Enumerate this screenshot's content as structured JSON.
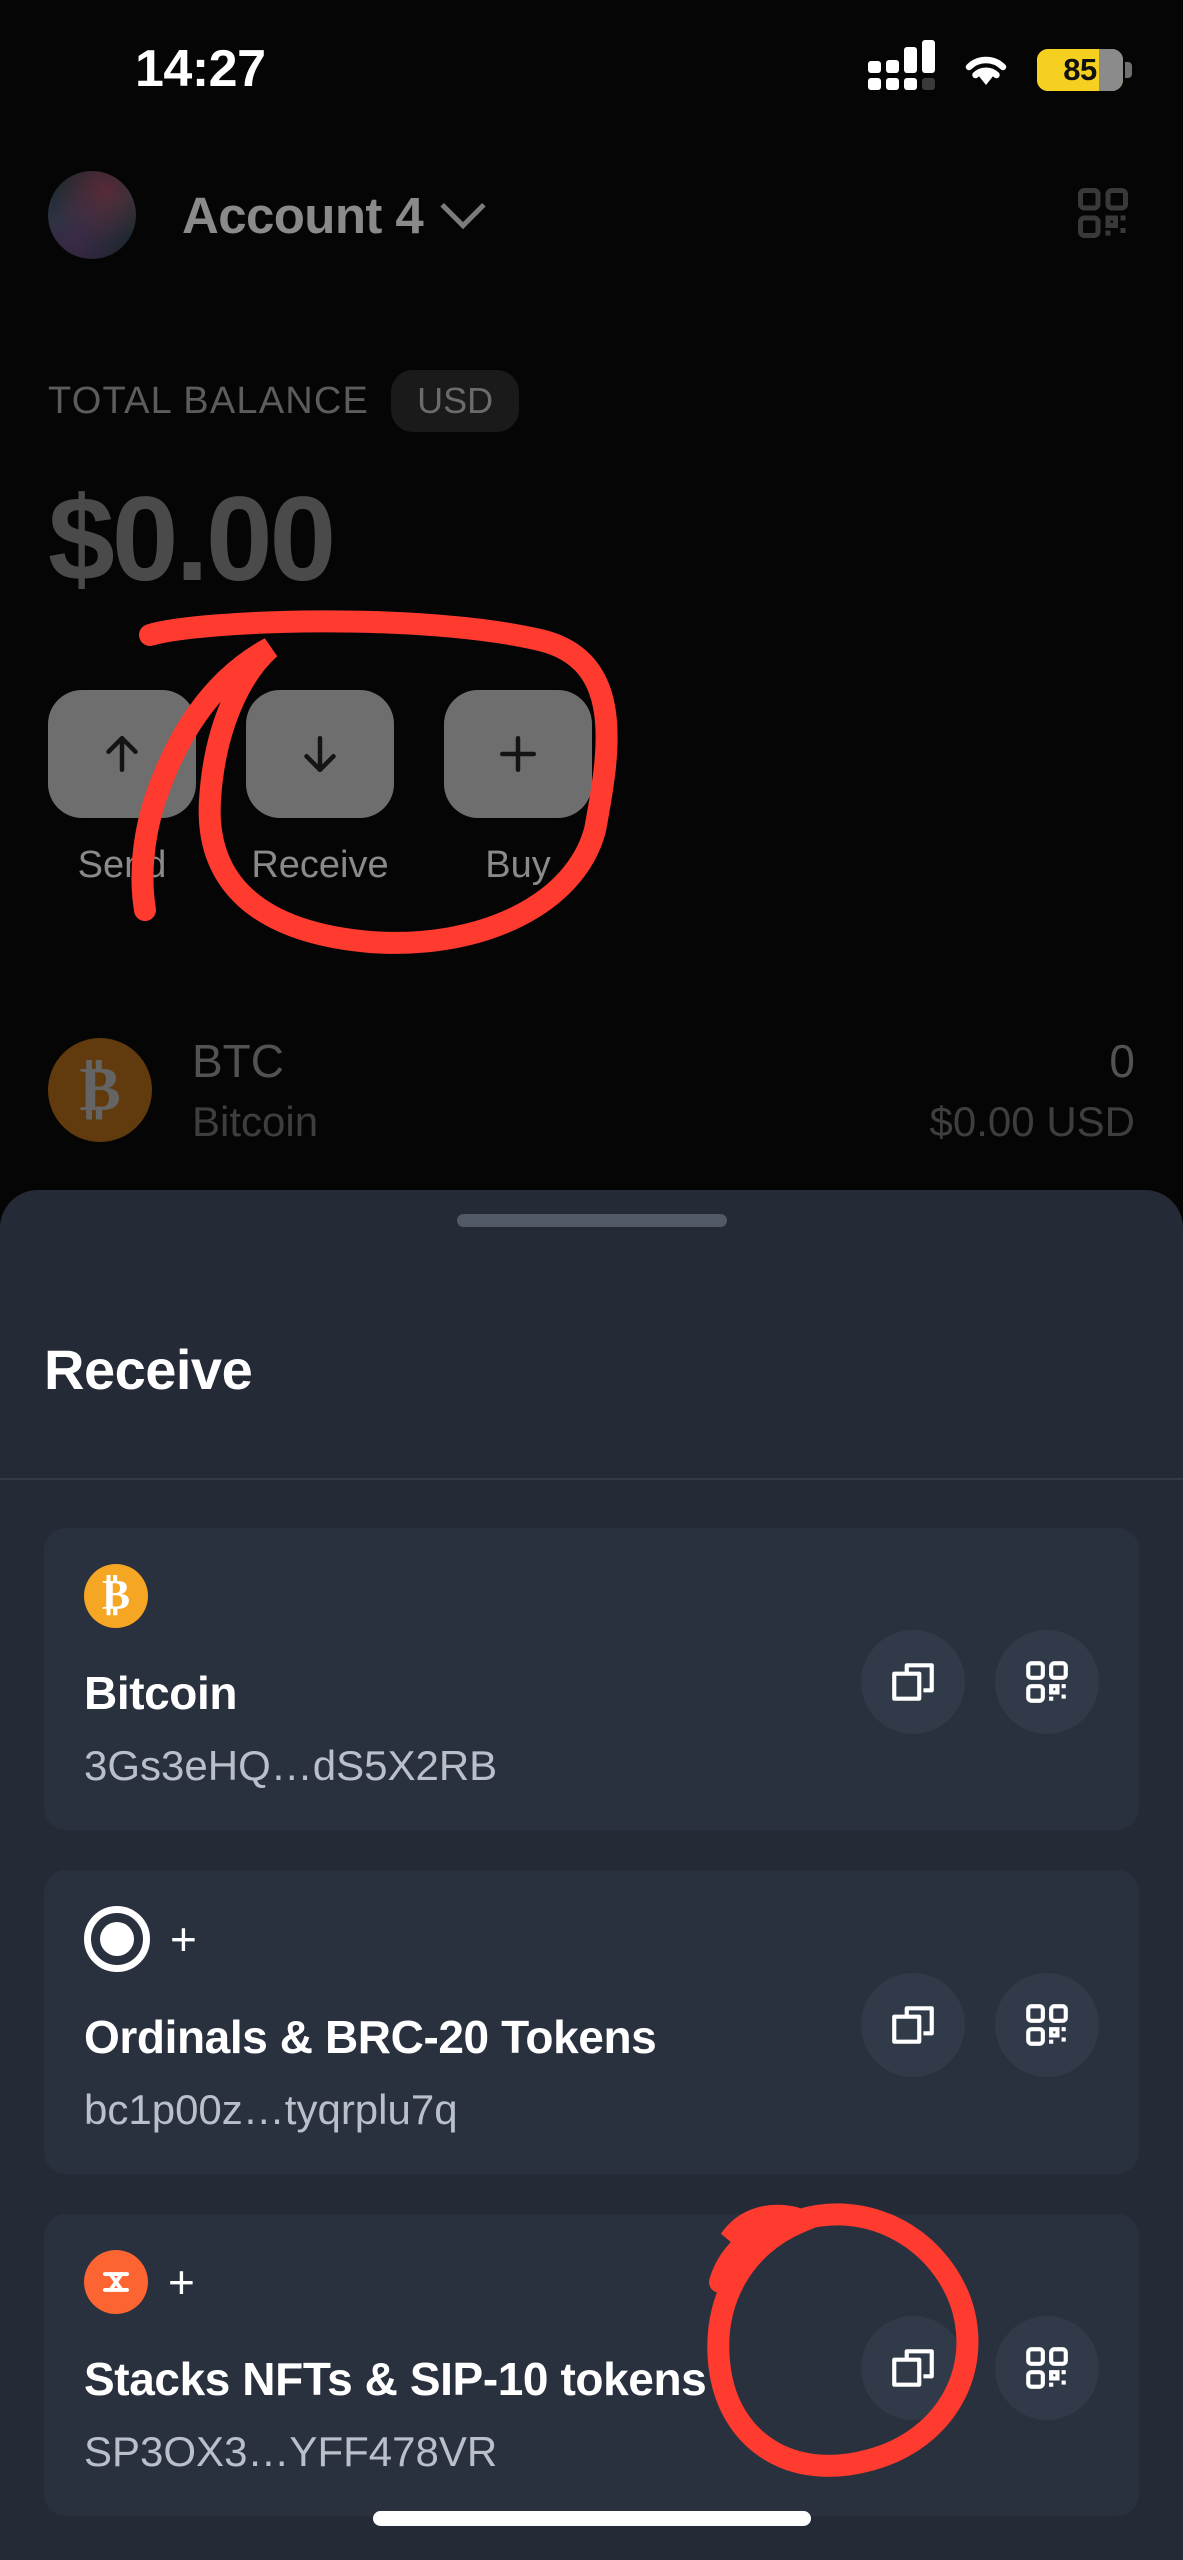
{
  "status_bar": {
    "time": "14:27",
    "battery_percent": "85",
    "signal_icon": "signal-bars-icon",
    "wifi_icon": "wifi-icon",
    "battery_icon": "battery-icon"
  },
  "header": {
    "account_name": "Account 4",
    "avatar_icon": "account-avatar",
    "chevron_icon": "chevron-down-icon",
    "qr_icon": "qr-scan-icon"
  },
  "balance": {
    "label": "TOTAL BALANCE",
    "currency": "USD",
    "amount": "$0.00"
  },
  "actions": [
    {
      "label": "Send",
      "icon": "arrow-up-icon"
    },
    {
      "label": "Receive",
      "icon": "arrow-down-icon"
    },
    {
      "label": "Buy",
      "icon": "plus-icon"
    }
  ],
  "assets": [
    {
      "symbol": "BTC",
      "name": "Bitcoin",
      "amount": "0",
      "fiat": "$0.00 USD",
      "icon": "bitcoin-icon"
    }
  ],
  "sheet": {
    "title": "Receive",
    "grabber_icon": "drag-handle",
    "cards": [
      {
        "title": "Bitcoin",
        "address": "3Gs3eHQ…dS5X2RB",
        "logo": "bitcoin-logo",
        "copy_icon": "copy-icon",
        "qr_icon": "qr-code-icon"
      },
      {
        "title": "Ordinals & BRC-20 Tokens",
        "address": "bc1p00z…tyqrplu7q",
        "logo": "ordinals-logo",
        "badge": "+",
        "copy_icon": "copy-icon",
        "qr_icon": "qr-code-icon"
      },
      {
        "title": "Stacks NFTs & SIP-10 tokens",
        "address": "SP3OX3…YFF478VR",
        "logo": "stacks-logo",
        "badge": "+",
        "copy_icon": "copy-icon",
        "qr_icon": "qr-code-icon"
      }
    ]
  },
  "annotations": {
    "color": "#FF3B30",
    "marks": [
      {
        "name": "circle-receive-buy",
        "target": "receive-and-buy-buttons"
      },
      {
        "name": "circle-copy-stacks",
        "target": "stacks-copy-button"
      }
    ]
  },
  "colors": {
    "background": "#050505",
    "sheet_bg": "#242a36",
    "card_bg": "#2a313e",
    "accent_orange": "#f5a623",
    "stacks_orange": "#fc6432",
    "battery_yellow": "#F5D020",
    "annotation_red": "#FF3B30"
  }
}
